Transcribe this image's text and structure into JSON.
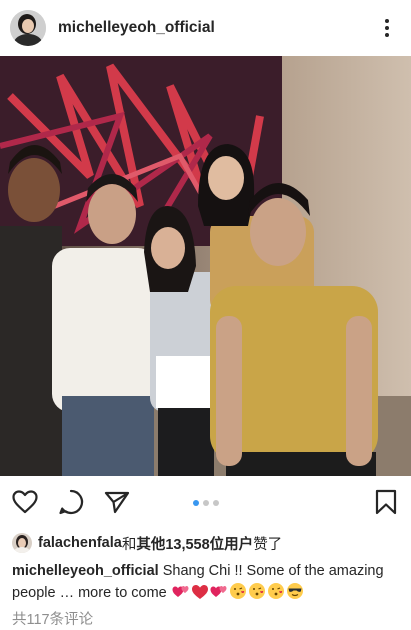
{
  "post": {
    "username": "michelleyeoh_official",
    "avatar_icon": "profile-avatar-icon",
    "more_icon": "more-vertical-icon"
  },
  "photo": {
    "description_icon": "group-photo"
  },
  "actions": {
    "like_icon": "heart-icon",
    "comment_icon": "comment-icon",
    "share_icon": "send-icon",
    "save_icon": "bookmark-icon",
    "carousel": {
      "count": 3,
      "active": 1
    }
  },
  "likes": {
    "first_user": "falachenfala",
    "connector": "和",
    "others": "其他13,558位用户",
    "suffix": "赞了"
  },
  "caption": {
    "username": "michelleyeoh_official",
    "text": "Shang Chi !! Some of the amazing people … more to come",
    "emojis": [
      "hearts-icon",
      "red-heart-icon",
      "hearts-icon",
      "kiss-face-icon",
      "kiss-face-icon",
      "kiss-face-icon",
      "sunglasses-face-icon"
    ]
  },
  "comments": {
    "label": "共117条评论"
  },
  "colors": {
    "accent": "#3897f0",
    "text": "#262626",
    "muted": "#8e8e8e"
  }
}
